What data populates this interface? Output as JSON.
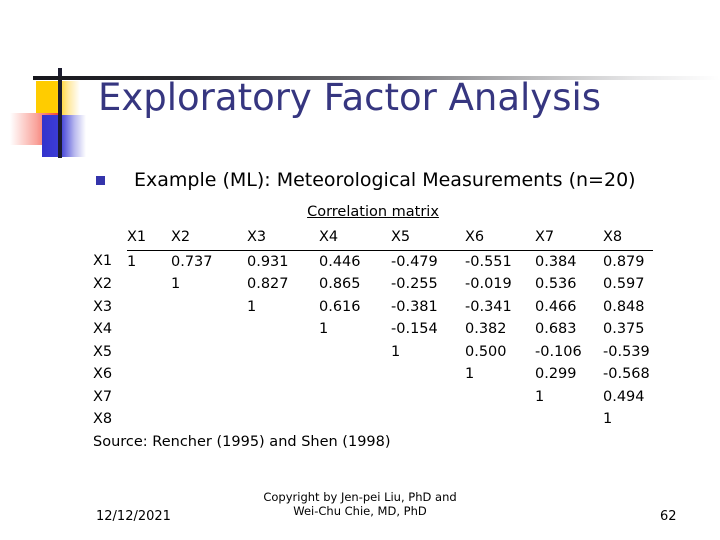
{
  "slide": {
    "title": "Exploratory Factor Analysis",
    "bullet": "Example (ML): Meteorological Measurements (n=20)",
    "matrix_caption": "Correlation matrix",
    "source": "Source: Rencher (1995) and Shen (1998)"
  },
  "colors": {
    "title": "#363680",
    "bullet_marker": "#3434ab",
    "deco_yellow": "#ffcc00",
    "deco_red": "#f44336",
    "deco_blue": "#3333cc",
    "rule": "#16161c"
  },
  "matrix": {
    "columns": [
      "X1",
      "X2",
      "X3",
      "X4",
      "X5",
      "X6",
      "X7",
      "X8"
    ],
    "rows": [
      {
        "label": "X1",
        "values": [
          "1",
          "0.737",
          "0.931",
          "0.446",
          "-0.479",
          "-0.551",
          "0.384",
          "0.879"
        ]
      },
      {
        "label": "X2",
        "values": [
          "",
          "1",
          "0.827",
          "0.865",
          "-0.255",
          "-0.019",
          "0.536",
          "0.597"
        ]
      },
      {
        "label": "X3",
        "values": [
          "",
          "",
          "1",
          "0.616",
          "-0.381",
          "-0.341",
          "0.466",
          "0.848"
        ]
      },
      {
        "label": "X4",
        "values": [
          "",
          "",
          "",
          "1",
          "-0.154",
          "0.382",
          "0.683",
          "0.375"
        ]
      },
      {
        "label": "X5",
        "values": [
          "",
          "",
          "",
          "",
          "1",
          "0.500",
          "-0.106",
          "-0.539"
        ]
      },
      {
        "label": "X6",
        "values": [
          "",
          "",
          "",
          "",
          "",
          "1",
          "0.299",
          "-0.568"
        ]
      },
      {
        "label": "X7",
        "values": [
          "",
          "",
          "",
          "",
          "",
          "",
          "1",
          "0.494"
        ]
      },
      {
        "label": "X8",
        "values": [
          "",
          "",
          "",
          "",
          "",
          "",
          "",
          "1"
        ]
      }
    ]
  },
  "footer": {
    "date": "12/12/2021",
    "copyright_line1": "Copyright by Jen-pei Liu, PhD and",
    "copyright_line2": "Wei-Chu Chie, MD, PhD",
    "page_number": "62"
  }
}
